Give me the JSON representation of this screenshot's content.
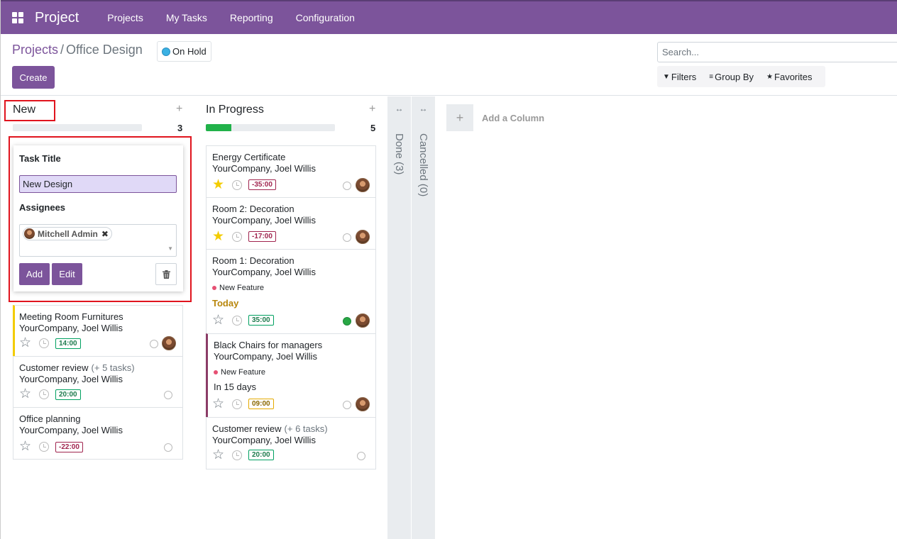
{
  "app": {
    "title": "Project",
    "menu": [
      "Projects",
      "My Tasks",
      "Reporting",
      "Configuration"
    ]
  },
  "breadcrumb": {
    "parent": "Projects",
    "separator": "/",
    "current": "Office Design"
  },
  "project_status": {
    "label": "On Hold",
    "color": "#3bb1e3"
  },
  "toolbar": {
    "create_label": "Create",
    "search_placeholder": "Search...",
    "filters_label": "Filters",
    "group_by_label": "Group By",
    "favorites_label": "Favorites"
  },
  "columns": [
    {
      "title": "New",
      "count": "3",
      "progress": 0
    },
    {
      "title": "In Progress",
      "count": "5",
      "progress": 0.2
    }
  ],
  "quick_create": {
    "task_title_label": "Task Title",
    "task_title_value": "New Design",
    "assignees_label": "Assignees",
    "assignee": "Mitchell Admin",
    "add_label": "Add",
    "edit_label": "Edit"
  },
  "new_cards": [
    {
      "title": "Meeting Room Furnitures",
      "subtasks": "",
      "company": "YourCompany, Joel Willis",
      "time": "14:00",
      "accent": "#f3cc00"
    },
    {
      "title": "Customer review",
      "subtasks": "(+ 5 tasks)",
      "company": "YourCompany, Joel Willis",
      "time": "20:00"
    },
    {
      "title": "Office planning",
      "subtasks": "",
      "company": "YourCompany, Joel Willis",
      "time": "-22:00"
    }
  ],
  "progress_cards": [
    {
      "title": "Energy Certificate",
      "subtasks": "",
      "company": "YourCompany, Joel Willis",
      "time": "-35:00"
    },
    {
      "title": "Room 2: Decoration",
      "subtasks": "",
      "company": "YourCompany, Joel Willis",
      "time": "-17:00"
    },
    {
      "title": "Room 1: Decoration",
      "subtasks": "",
      "company": "YourCompany, Joel Willis",
      "tag": "New Feature",
      "deadline": "Today",
      "time": "35:00"
    },
    {
      "title": "Black Chairs for managers",
      "subtasks": "",
      "company": "YourCompany, Joel Willis",
      "tag": "New Feature",
      "deadline": "In 15 days",
      "time": "09:00",
      "accent": "#8b3c67"
    },
    {
      "title": "Customer review",
      "subtasks": "(+ 6 tasks)",
      "company": "YourCompany, Joel Willis",
      "time": "20:00"
    }
  ],
  "folded_columns": [
    "Done (3)",
    "Cancelled (0)"
  ],
  "add_column_label": "Add a Column",
  "colors": {
    "brand": "#7c549b",
    "highlight": "#e0141e"
  }
}
